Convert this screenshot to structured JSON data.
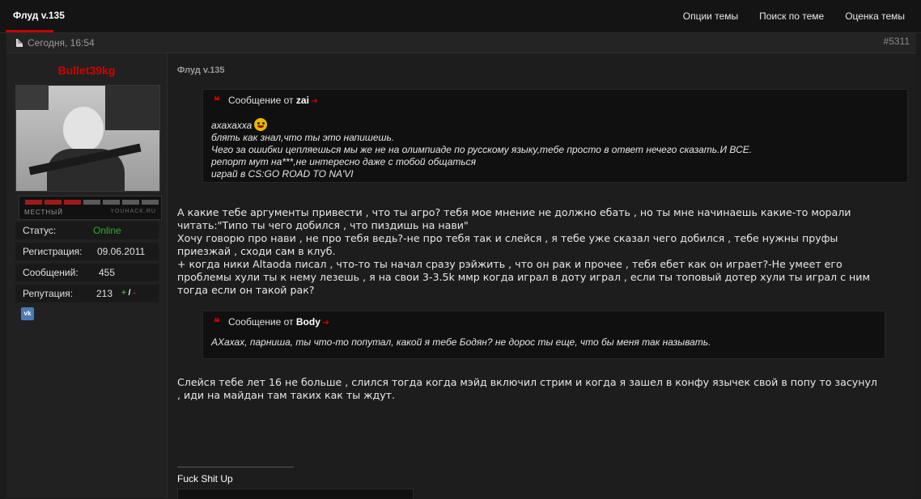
{
  "header": {
    "thread_title": "Флуд v.135",
    "links": [
      "Опции темы",
      "Поиск по теме",
      "Оценка темы"
    ]
  },
  "post": {
    "date": "Сегодня, 16:54",
    "number": "#5311",
    "title": "Флуд v.135"
  },
  "user": {
    "name": "Bullet39kg",
    "rank_title": "МЕСТНЫЙ",
    "rank_site": "YOUHACK.RU",
    "rank_filled_color": "#a01a1a",
    "rank_empty_color": "#5a5a5a",
    "rank_level": "3 of 7",
    "stats": [
      {
        "label": "Статус:",
        "value": "Online",
        "color": "#2fae2f"
      },
      {
        "label": "Регистрация:",
        "value": "09.06.2011",
        "color": "#e0e0e0"
      },
      {
        "label": "Сообщений:",
        "value": "455",
        "color": "#e0e0e0"
      },
      {
        "label": "Репутация:",
        "value": "213",
        "color": "#e0e0e0"
      }
    ],
    "rep_plus": "+",
    "rep_slash": "/",
    "rep_minus": "-",
    "social_icon": "vk-icon",
    "social_label": "vk"
  },
  "quotes": [
    {
      "prefix": "Сообщение от",
      "author": "zai",
      "lines": [
        "ахахахха",
        "блять как знал,что ты это напишешь.",
        "Чего за ошибки цепляешься мы же не на олимпиаде по русскому языку,тебе просто в ответ нечего сказать.И ВСЕ.",
        "репорт мут на***,не интересно даже с тобой общаться",
        "играй в CS:GO ROAD TO NA'VI"
      ]
    },
    {
      "prefix": "Сообщение от",
      "author": "Body",
      "lines": [
        "АХахах, парниша, ты что-то попутал, какой я тебе Бодян? не дорос ты еще, что бы меня так называть."
      ]
    }
  ],
  "body": {
    "paragraph1": [
      "А какие тебе аргументы привести , что ты агро? тебя мое мнение не должно ебать , но ты мне начинаешь какие-то морали",
      "читать:\"Типо ты чего добился , что пиздишь на нави\"",
      "Хочу говорю про нави , не про тебя ведь?-не про тебя так и слейся , я тебе уже сказал чего добился , тебе нужны пруфы",
      "приезжай , сходи сам в клуб.",
      "+ когда ники Altaoda писал , что-то ты начал сразу рэйжить , что он рак и прочее , тебя ебет как он играет?-Не умеет его",
      "проблемы хули ты к нему лезешь , я на свои 3-3.5k ммр когда играл в доту играл , если ты топовый дотер хули ты играл с ним",
      "тогда если он такой рак?"
    ],
    "paragraph2": [
      "Слейся тебе лет 16 не больше , слился тогда когда мэйд включил стрим и когда я зашел в конфу язычек свой в попу то засунул",
      ", иди на майдан там таких как ты ждут."
    ]
  },
  "signature": "Fuck Shit Up"
}
